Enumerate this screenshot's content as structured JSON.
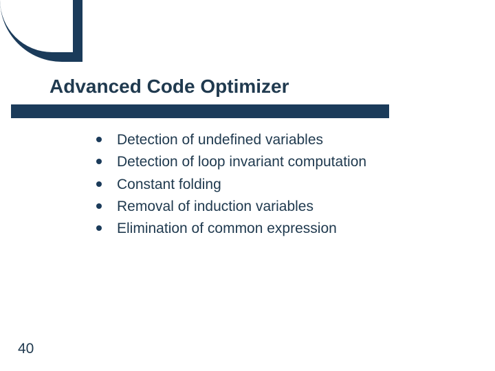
{
  "slide": {
    "title": "Advanced Code Optimizer",
    "bullets": [
      "Detection of undefined variables",
      "Detection of loop invariant computation",
      "Constant folding",
      "Removal of induction variables",
      "Elimination of common expression"
    ],
    "page_number": "40"
  }
}
